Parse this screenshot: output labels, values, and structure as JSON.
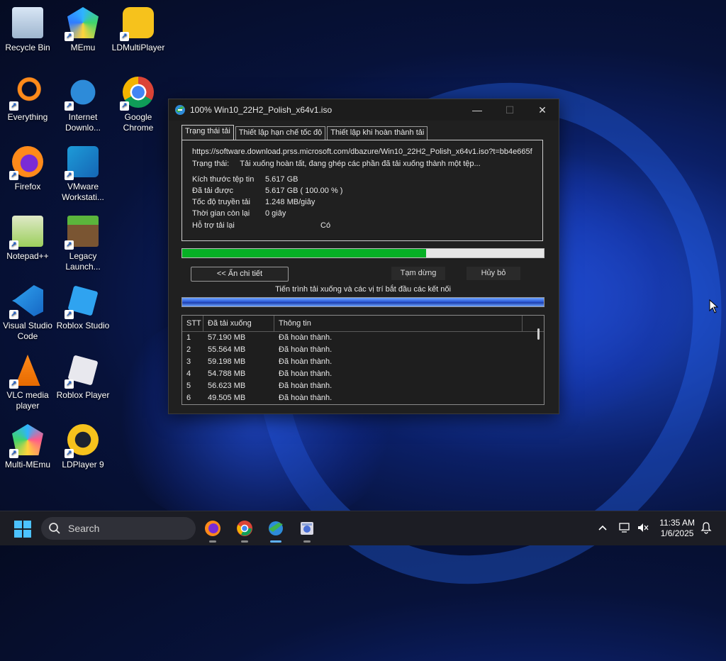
{
  "desktop_icons": [
    {
      "label": "Recycle Bin",
      "icon": "recycle-bin-icon"
    },
    {
      "label": "MEmu",
      "icon": "memu-icon"
    },
    {
      "label": "LDMultiPlayer",
      "icon": "ldmultiplayer-icon"
    },
    {
      "label": "Everything",
      "icon": "everything-icon"
    },
    {
      "label": "Internet Downlo...",
      "icon": "idm-icon"
    },
    {
      "label": "Google Chrome",
      "icon": "chrome-icon"
    },
    {
      "label": "Firefox",
      "icon": "firefox-icon"
    },
    {
      "label": "VMware Workstati...",
      "icon": "vmware-icon"
    },
    {
      "label": "Notepad++",
      "icon": "notepadpp-icon"
    },
    {
      "label": "Legacy Launch...",
      "icon": "legacy-launcher-icon"
    },
    {
      "label": "Visual Studio Code",
      "icon": "vscode-icon"
    },
    {
      "label": "Roblox Studio",
      "icon": "roblox-studio-icon"
    },
    {
      "label": "VLC media player",
      "icon": "vlc-icon"
    },
    {
      "label": "Roblox Player",
      "icon": "roblox-player-icon"
    },
    {
      "label": "Multi-MEmu",
      "icon": "multi-memu-icon"
    },
    {
      "label": "LDPlayer 9",
      "icon": "ldplayer-icon"
    }
  ],
  "window": {
    "title": "100% Win10_22H2_Polish_x64v1.iso",
    "controls": {
      "minimize": "—",
      "maximize": "☐",
      "close": "✕"
    },
    "tabs": [
      "Trạng thái tải",
      "Thiết lập hạn chế tốc độ",
      "Thiết lập khi hoàn thành tải"
    ],
    "url": "https://software.download.prss.microsoft.com/dbazure/Win10_22H2_Polish_x64v1.iso?t=bb4e665f",
    "status_label": "Trạng thái:",
    "status_value": "Tải xuống hoàn tất, đang ghép các phần đã tải xuống thành một tệp...",
    "file_size_label": "Kích thước tệp tin",
    "file_size_value": "5.617  GB",
    "downloaded_label": "Đã tải được",
    "downloaded_value": "5.617  GB  ( 100.00 % )",
    "speed_label": "Tốc độ truyền tải",
    "speed_value": "1.248  MB/giây",
    "time_left_label": "Thời gian còn lại",
    "time_left_value": "0 giây",
    "resume_label": "Hỗ trợ tải lại",
    "resume_value": "Có",
    "progress_fraction": 0.675,
    "hide_details_button": "<< Ẩn chi tiết",
    "pause_button": "Tạm dừng",
    "cancel_button": "Hủy bỏ",
    "segments_caption": "Tiến trình tải xuống và các vị trí bắt đầu các kết nối",
    "table": {
      "headers": [
        "STT",
        "Đã tải xuống",
        "Thông tin"
      ],
      "rows": [
        [
          "1",
          "57.190  MB",
          "Đã hoàn thành."
        ],
        [
          "2",
          "55.564  MB",
          "Đã hoàn thành."
        ],
        [
          "3",
          "59.198  MB",
          "Đã hoàn thành."
        ],
        [
          "4",
          "54.788  MB",
          "Đã hoàn thành."
        ],
        [
          "5",
          "56.623  MB",
          "Đã hoàn thành."
        ],
        [
          "6",
          "49.505  MB",
          "Đã hoàn thành."
        ]
      ]
    }
  },
  "taskbar": {
    "search_placeholder": "Search",
    "time": "11:35 AM",
    "date": "1/6/2025",
    "apps": [
      "firefox-icon",
      "chrome-icon",
      "idm-icon",
      "app-icon"
    ]
  },
  "colors": {
    "progress": "#06b025",
    "accent": "#0078d4"
  }
}
